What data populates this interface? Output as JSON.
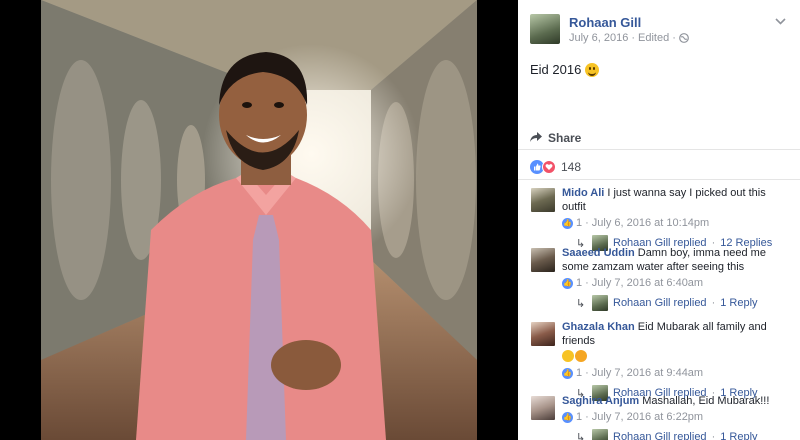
{
  "post": {
    "author": "Rohaan Gill",
    "date": "July 6, 2016",
    "edited": "Edited",
    "separator": "·",
    "text": "Eid 2016",
    "share_label": "Share",
    "reaction_count": "148"
  },
  "comments": [
    {
      "author": "Mido Ali",
      "text": "I just wanna say I picked out this outfit",
      "likes": "1",
      "time": "July 6, 2016 at 10:14pm",
      "reply_author": "Rohaan Gill replied",
      "reply_count": "12 Replies"
    },
    {
      "author": "Saaeed Uddin",
      "text": "Damn boy, imma need me some zamzam water after seeing this",
      "likes": "1",
      "time": "July 7, 2016 at 6:40am",
      "reply_author": "Rohaan Gill replied",
      "reply_count": "1 Reply"
    },
    {
      "author": "Ghazala Khan",
      "text": "Eid Mubarak all family and friends",
      "likes": "1",
      "time": "July 7, 2016 at 9:44am",
      "reply_author": "Rohaan Gill replied",
      "reply_count": "1 Reply"
    },
    {
      "author": "Saghira Anjum",
      "text": "Mashallah, Eid Mubarak!!!",
      "likes": "1",
      "time": "July 7, 2016 at 6:22pm",
      "reply_author": "Rohaan Gill replied",
      "reply_count": "1 Reply"
    }
  ],
  "icons": {
    "globe": "globe-icon",
    "chevron": "chevron-down-icon",
    "share": "share-arrow-icon",
    "like": "like-thumb-icon",
    "love": "love-heart-icon",
    "reply": "reply-arrow-icon"
  },
  "colors": {
    "link": "#365899",
    "meta": "#90949c",
    "like_blue": "#5890ff",
    "love_red": "#f25268",
    "shirt_pink": "#e88a88",
    "tie_lavender": "#b89ab8"
  }
}
